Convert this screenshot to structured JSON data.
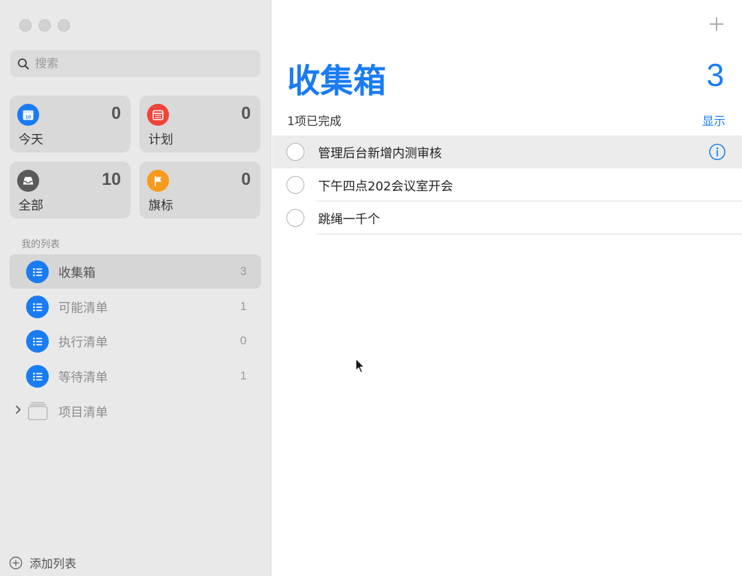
{
  "window": {
    "controls": [
      "close",
      "minimize",
      "zoom"
    ]
  },
  "search": {
    "placeholder": "搜索",
    "value": ""
  },
  "smart_lists": [
    {
      "label": "今天",
      "count": "0",
      "icon": "calendar-today-icon",
      "color": "#1a7cf2"
    },
    {
      "label": "计划",
      "count": "0",
      "icon": "calendar-scheduled-icon",
      "color": "#f0433a"
    },
    {
      "label": "全部",
      "count": "10",
      "icon": "tray-icon",
      "color": "#5a5a5a"
    },
    {
      "label": "旗标",
      "count": "0",
      "icon": "flag-icon",
      "color": "#f89a1c"
    }
  ],
  "my_lists": {
    "title": "我的列表",
    "items": [
      {
        "label": "收集箱",
        "count": "3",
        "selected": true
      },
      {
        "label": "可能清单",
        "count": "1",
        "selected": false
      },
      {
        "label": "执行清单",
        "count": "0",
        "selected": false
      },
      {
        "label": "等待清单",
        "count": "1",
        "selected": false
      }
    ],
    "group": {
      "label": "项目清单",
      "expanded": false
    }
  },
  "add_list_label": "添加列表",
  "main": {
    "title": "收集箱",
    "count": "3",
    "completed_text": "1项已完成",
    "show_label": "显示",
    "tasks": [
      {
        "text": "管理后台新增内测审核",
        "highlighted": true
      },
      {
        "text": "下午四点202会议室开会",
        "highlighted": false
      },
      {
        "text": "跳绳一千个",
        "highlighted": false
      }
    ]
  },
  "colors": {
    "accent": "#1a7cf2",
    "sidebar_bg": "#e9e9e9"
  }
}
